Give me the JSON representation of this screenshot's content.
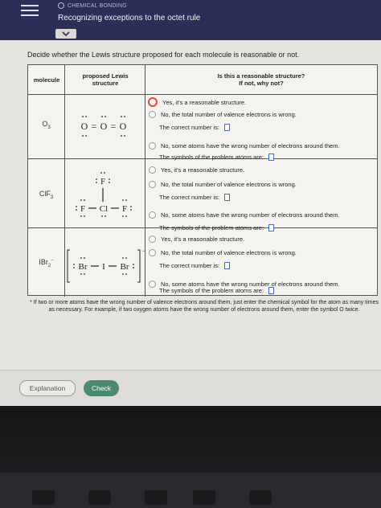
{
  "header": {
    "module": "CHEMICAL BONDING",
    "title": "Recognizing exceptions to the octet rule"
  },
  "instruction": "Decide whether the Lewis structure proposed for each molecule is reasonable or not.",
  "table": {
    "col_molecule": "molecule",
    "col_proposed_line1": "proposed Lewis",
    "col_proposed_line2": "structure",
    "col_question_line1": "Is this a reasonable structure?",
    "col_question_line2": "If not, why not?"
  },
  "options": {
    "yes": "Yes, it's a reasonable structure.",
    "valence": "No, the total number of valence electrons is wrong.",
    "correct_number": "The correct number is:",
    "wrong_atoms": "No, some atoms have the wrong number of electrons around them.",
    "symbols": "The symbols of the problem atoms are:"
  },
  "molecules": [
    {
      "base": "O",
      "sub": "3",
      "selected": "yes"
    },
    {
      "base": "ClF",
      "sub": "3",
      "selected": "none"
    },
    {
      "base": "IBr",
      "sub": "2",
      "selected": "none",
      "sup": "−"
    }
  ],
  "structures": {
    "o3": {
      "atom": "O",
      "bond": "="
    },
    "clf3": {
      "center": "Cl",
      "outer": "F"
    },
    "ibr2": {
      "center": "I",
      "outer": "Br",
      "charge": "−"
    }
  },
  "footnote": "* If two or more atoms have the wrong number of valence electrons around them, just enter the chemical symbol for the atom as many times as necessary. For example, if two oxygen atoms have the wrong number of electrons around them, enter the symbol O twice.",
  "buttons": {
    "explanation": "Explanation",
    "check": "Check"
  },
  "colors": {
    "header_bg": "#2b2e57",
    "check_bg": "#4b8a70",
    "selected_radio": "#e24a3a"
  }
}
